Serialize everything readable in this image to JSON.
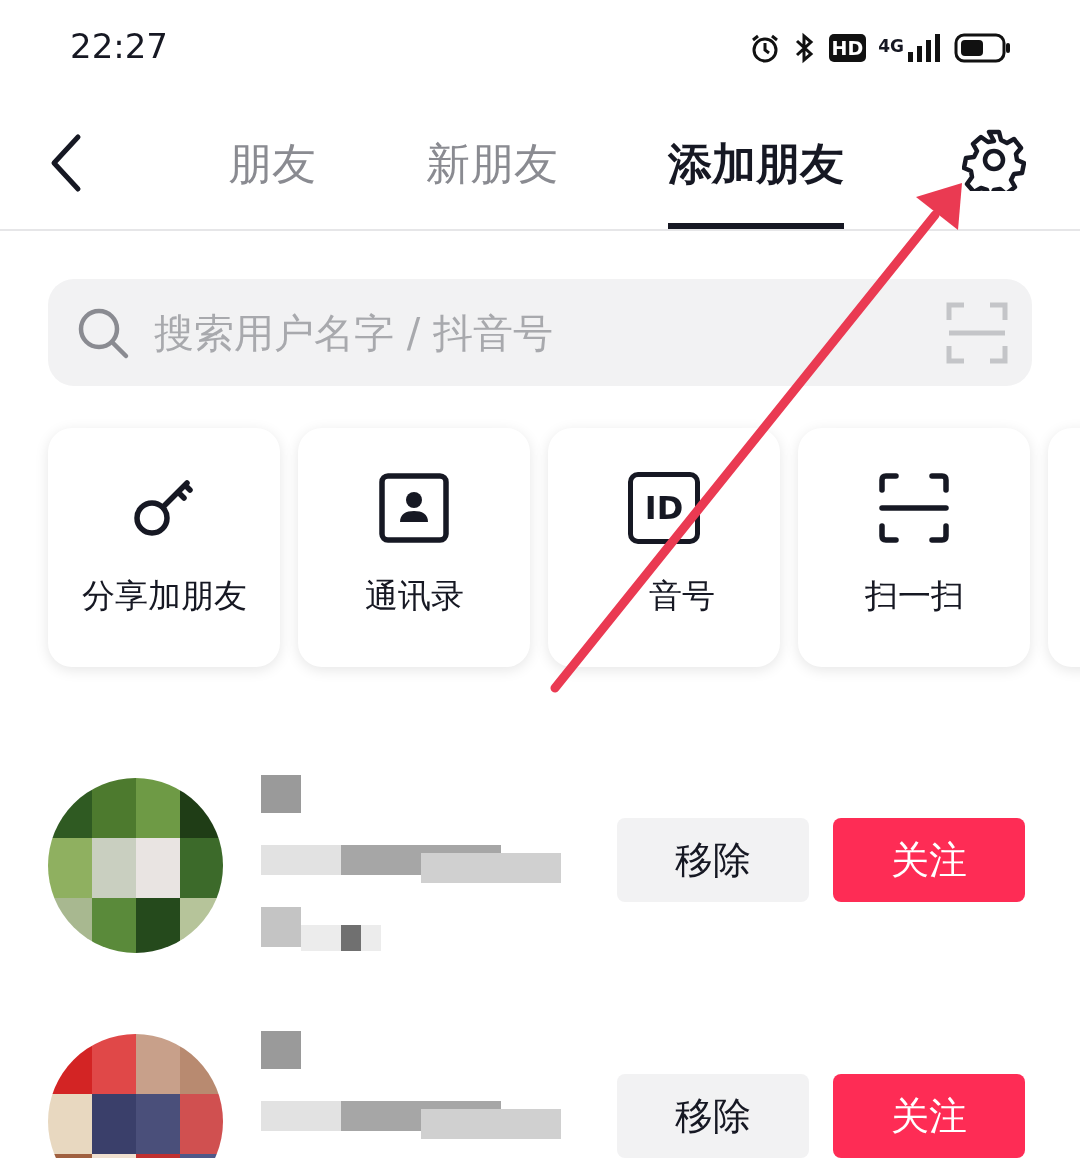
{
  "status_bar": {
    "time": "22:27",
    "hd": "HD",
    "network": "4G"
  },
  "tabs": [
    {
      "label": "朋友",
      "selected": false
    },
    {
      "label": "新朋友",
      "selected": false
    },
    {
      "label": "添加朋友",
      "selected": true
    }
  ],
  "search": {
    "placeholder": "搜索用户名字 / 抖音号"
  },
  "shortcuts": [
    {
      "kind": "key",
      "label": "分享加朋友"
    },
    {
      "kind": "contacts",
      "label": "通讯录"
    },
    {
      "kind": "id",
      "label": "音号",
      "icon_text": "ID"
    },
    {
      "kind": "scan",
      "label": "扫一扫"
    },
    {
      "kind": "partial"
    }
  ],
  "suggestions": [
    {
      "remove": "移除",
      "follow": "关注"
    },
    {
      "remove": "移除",
      "follow": "关注"
    }
  ],
  "annotation": {
    "kind": "arrow"
  }
}
